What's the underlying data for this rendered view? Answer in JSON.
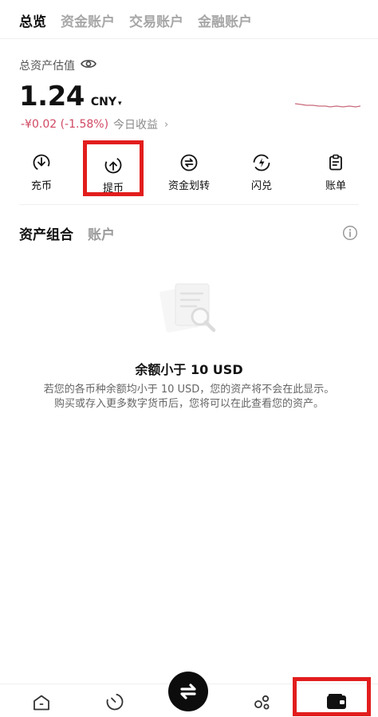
{
  "tabs": [
    {
      "label": "总览",
      "active": true
    },
    {
      "label": "资金账户",
      "active": false
    },
    {
      "label": "交易账户",
      "active": false
    },
    {
      "label": "金融账户",
      "active": false
    }
  ],
  "overview": {
    "total_label": "总资产估值",
    "balance": "1.24",
    "currency": "CNY",
    "caret": "▾",
    "pnl_value": "-¥0.02 (-1.58%)",
    "pnl_label": "今日收益",
    "pnl_arrow": "›"
  },
  "actions": [
    {
      "label": "充币",
      "icon": "deposit-icon",
      "highlighted": false
    },
    {
      "label": "提币",
      "icon": "withdraw-icon",
      "highlighted": true
    },
    {
      "label": "资金划转",
      "icon": "transfer-icon",
      "highlighted": false
    },
    {
      "label": "闪兑",
      "icon": "flash-swap-icon",
      "highlighted": false
    },
    {
      "label": "账单",
      "icon": "bill-icon",
      "highlighted": false
    }
  ],
  "section": {
    "tab_active": "资产组合",
    "tab_inactive": "账户"
  },
  "empty_state": {
    "title": "余额小于 10 USD",
    "desc_line1": "若您的各币种余额均小于 10 USD，您的资产将不会在此显示。",
    "desc_line2": "购买或存入更多数字货币后，您将可以在此查看您的资产。"
  },
  "bottom_nav": [
    {
      "name": "home-icon",
      "highlighted": false
    },
    {
      "name": "market-icon",
      "highlighted": false
    },
    {
      "name": "trade-swap-icon",
      "highlighted": false
    },
    {
      "name": "discover-icon",
      "highlighted": false
    },
    {
      "name": "wallet-icon",
      "highlighted": true
    }
  ],
  "colors": {
    "accent_negative": "#d04863",
    "highlight_box": "#e21d1d",
    "text_primary": "#111111",
    "text_inactive": "#a7a7a7"
  }
}
